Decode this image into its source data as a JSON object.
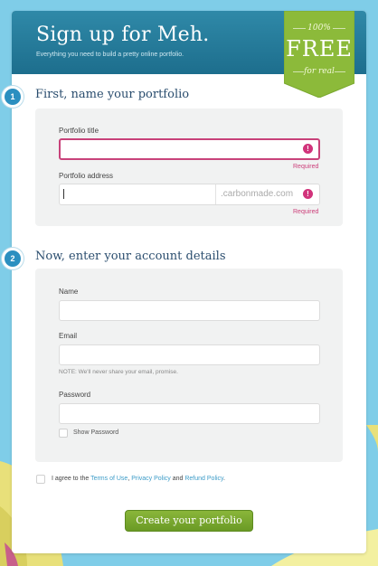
{
  "header": {
    "title": "Sign up for Meh.",
    "subtitle": "Everything you need to build a pretty online portfolio."
  },
  "ribbon": {
    "top": "100%",
    "main": "FREE",
    "bottom": "for real"
  },
  "step1": {
    "number": "1",
    "title": "First, name your portfolio",
    "portfolio_title": {
      "label": "Portfolio title",
      "value": "",
      "error": "Required",
      "error_icon": "!"
    },
    "portfolio_address": {
      "label": "Portfolio address",
      "value": "",
      "suffix": ".carbonmade.com",
      "error": "Required",
      "error_icon": "!"
    }
  },
  "step2": {
    "number": "2",
    "title": "Now, enter your account details",
    "name": {
      "label": "Name",
      "value": ""
    },
    "email": {
      "label": "Email",
      "value": "",
      "note": "NOTE: We'll never share your email, promise."
    },
    "password": {
      "label": "Password",
      "value": ""
    },
    "show_password": {
      "label": "Show Password",
      "checked": false
    }
  },
  "terms": {
    "prefix": "I agree to the ",
    "terms_link": "Terms of Use",
    "sep1": ", ",
    "privacy_link": "Privacy Policy",
    "sep2": " and ",
    "refund_link": "Refund Policy",
    "suffix": ".",
    "checked": false
  },
  "cta": {
    "label": "Create your portfolio"
  },
  "colors": {
    "header": "#1d6e8d",
    "ribbon": "#8cba3a",
    "error": "#c8427a",
    "accent_link": "#3d9cc8",
    "cta": "#7aa82f",
    "background": "#7fcde8"
  }
}
